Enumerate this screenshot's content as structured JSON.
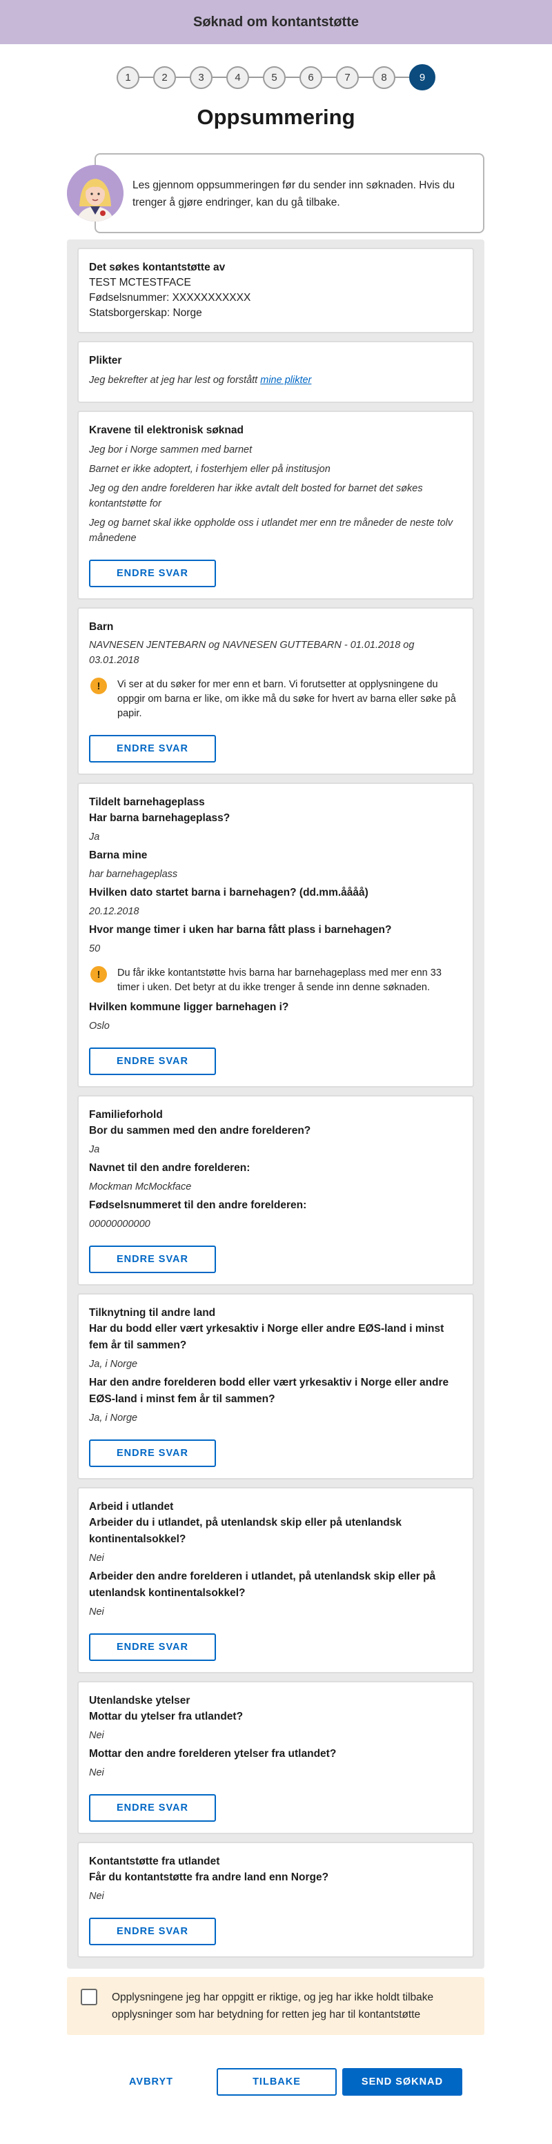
{
  "header": {
    "title": "Søknad om kontantstøtte"
  },
  "stepper": {
    "steps": [
      "1",
      "2",
      "3",
      "4",
      "5",
      "6",
      "7",
      "8",
      "9"
    ],
    "active": "9"
  },
  "page_title": "Oppsummering",
  "intro": {
    "text": "Les gjennom oppsummeringen før du sender inn søknaden. Hvis du trenger å gjøre endringer, kan du gå tilbake."
  },
  "edit_label": "ENDRE SVAR",
  "sections": {
    "applicant": {
      "title": "Det søkes kontantstøtte av",
      "name": "TEST MCTESTFACE",
      "ssn": "Fødselsnummer: XXXXXXXXXXX",
      "citizenship": "Statsborgerskap: Norge"
    },
    "duties": {
      "title": "Plikter",
      "text": "Jeg bekrefter at jeg har lest og forstått",
      "link": "mine plikter"
    },
    "requirements": {
      "title": "Kravene til elektronisk søknad",
      "items": [
        "Jeg bor i Norge sammen med barnet",
        "Barnet er ikke adoptert, i fosterhjem eller på institusjon",
        "Jeg og den andre forelderen har ikke avtalt delt bosted for barnet det søkes kontantstøtte for",
        "Jeg og barnet skal ikke oppholde oss i utlandet mer enn tre måneder de neste tolv månedene"
      ]
    },
    "child": {
      "title": "Barn",
      "names": "NAVNESEN JENTEBARN og NAVNESEN GUTTEBARN - 01.01.2018 og 03.01.2018",
      "alert": "Vi ser at du søker for mer enn et barn. Vi forutsetter at opplysningene du oppgir om barna er like, om ikke må du søke for hvert av barna eller søke på papir."
    },
    "kindergarten": {
      "title": "Tildelt barnehageplass",
      "q1": "Har barna barnehageplass?",
      "a1": "Ja",
      "q2": "Barna mine",
      "a2": "har barnehageplass",
      "q3": "Hvilken dato startet barna i barnehagen? (dd.mm.åååå)",
      "a3": "20.12.2018",
      "q4": "Hvor mange timer i uken har barna fått plass i barnehagen?",
      "a4": "50",
      "alert": "Du får ikke kontantstøtte hvis barna har barnehageplass med mer enn 33 timer i uken. Det betyr at du ikke trenger å sende inn denne søknaden.",
      "q5": "Hvilken kommune ligger barnehagen i?",
      "a5": "Oslo"
    },
    "family": {
      "title": "Familieforhold",
      "q1": "Bor du sammen med den andre forelderen?",
      "a1": "Ja",
      "q2": "Navnet til den andre forelderen:",
      "a2": "Mockman McMockface",
      "q3": "Fødselsnummeret til den andre forelderen:",
      "a3": "00000000000"
    },
    "connection": {
      "title": "Tilknytning til andre land",
      "q1": "Har du bodd eller vært yrkesaktiv i Norge eller andre EØS-land i minst fem år til sammen?",
      "a1": "Ja, i Norge",
      "q2": "Har den andre forelderen bodd eller vært yrkesaktiv i Norge eller andre EØS-land i minst fem år til sammen?",
      "a2": "Ja, i Norge"
    },
    "work_abroad": {
      "title": "Arbeid i utlandet",
      "q1": "Arbeider du i utlandet, på utenlandsk skip eller på utenlandsk kontinentalsokkel?",
      "a1": "Nei",
      "q2": "Arbeider den andre forelderen i utlandet, på utenlandsk skip eller på utenlandsk kontinentalsokkel?",
      "a2": "Nei"
    },
    "foreign_benefits": {
      "title": "Utenlandske ytelser",
      "q1": "Mottar du ytelser fra utlandet?",
      "a1": "Nei",
      "q2": "Mottar den andre forelderen ytelser fra utlandet?",
      "a2": "Nei"
    },
    "foreign_support": {
      "title": "Kontantstøtte fra utlandet",
      "q1": "Får du kontantstøtte fra andre land enn Norge?",
      "a1": "Nei"
    }
  },
  "confirmation": {
    "text": "Opplysningene jeg har oppgitt er riktige, og jeg har ikke holdt tilbake opplysninger som har betydning for retten jeg har til kontantstøtte"
  },
  "actions": {
    "cancel": "AVBRYT",
    "back": "TILBAKE",
    "submit": "SEND SØKNAD"
  },
  "colors": {
    "header_bg": "#c6b8d6",
    "accent": "#0067c5",
    "step_active": "#0b4b7d",
    "warning": "#f5a623",
    "confirm_bg": "#fdf0dc"
  }
}
